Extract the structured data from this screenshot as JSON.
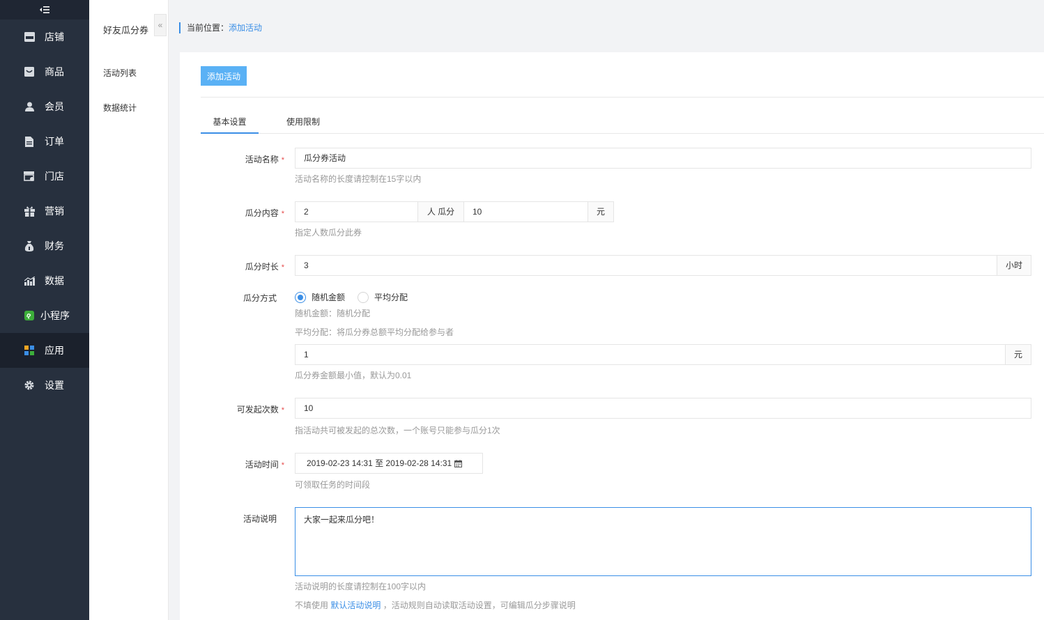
{
  "sidebar": {
    "collapse_icon": "list-collapse-icon",
    "items": [
      {
        "label": "店铺",
        "icon": "shop-icon"
      },
      {
        "label": "商品",
        "icon": "goods-icon"
      },
      {
        "label": "会员",
        "icon": "user-icon"
      },
      {
        "label": "订单",
        "icon": "order-icon"
      },
      {
        "label": "门店",
        "icon": "store-icon"
      },
      {
        "label": "营销",
        "icon": "gift-icon"
      },
      {
        "label": "财务",
        "icon": "money-bag-icon"
      },
      {
        "label": "数据",
        "icon": "bar-chart-icon"
      },
      {
        "label": "小程序",
        "icon": "mini-program-icon"
      },
      {
        "label": "应用",
        "icon": "apps-icon",
        "active": true
      },
      {
        "label": "设置",
        "icon": "gear-icon"
      }
    ]
  },
  "submenu": {
    "title": "好友瓜分券",
    "toggle_glyph": "«",
    "items": [
      "活动列表",
      "数据统计"
    ]
  },
  "breadcrumb": {
    "prefix": "当前位置：",
    "current": "添加活动"
  },
  "toolbar": {
    "add_label": "添加活动"
  },
  "tabs": [
    "基本设置",
    "使用限制"
  ],
  "form": {
    "name": {
      "label": "活动名称",
      "value": "瓜分券活动",
      "help": "活动名称的长度请控制在15字以内"
    },
    "content": {
      "label": "瓜分内容",
      "people": "2",
      "people_unit": "人 瓜分",
      "amount": "10",
      "amount_unit": "元",
      "help": "指定人数瓜分此券"
    },
    "duration": {
      "label": "瓜分时长",
      "value": "3",
      "unit": "小时"
    },
    "method": {
      "label": "瓜分方式",
      "options": [
        "随机金额",
        "平均分配"
      ],
      "selected": "随机金额",
      "help1": "随机金额：随机分配",
      "help2": "平均分配：将瓜分券总额平均分配给参与者",
      "min_value": "1",
      "min_unit": "元",
      "min_help": "瓜分券金额最小值，默认为0.01"
    },
    "times": {
      "label": "可发起次数",
      "value": "10",
      "help": "指活动共可被发起的总次数，一个账号只能参与瓜分1次"
    },
    "period": {
      "label": "活动时间",
      "value": "2019-02-23 14:31 至 2019-02-28 14:31",
      "help": "可领取任务的时间段"
    },
    "desc": {
      "label": "活动说明",
      "value": "大家一起来瓜分吧！",
      "help1": "活动说明的长度请控制在100字以内",
      "help2_pre": "不填使用",
      "help2_link": "默认活动说明",
      "help2_post": "，活动规则自动读取活动设置，可编辑瓜分步骤说明"
    }
  },
  "colors": {
    "accent": "#3a8ee6",
    "sidebar_bg": "#27303e",
    "button_bg": "#5ab1f5",
    "required": "#e64c4c"
  }
}
